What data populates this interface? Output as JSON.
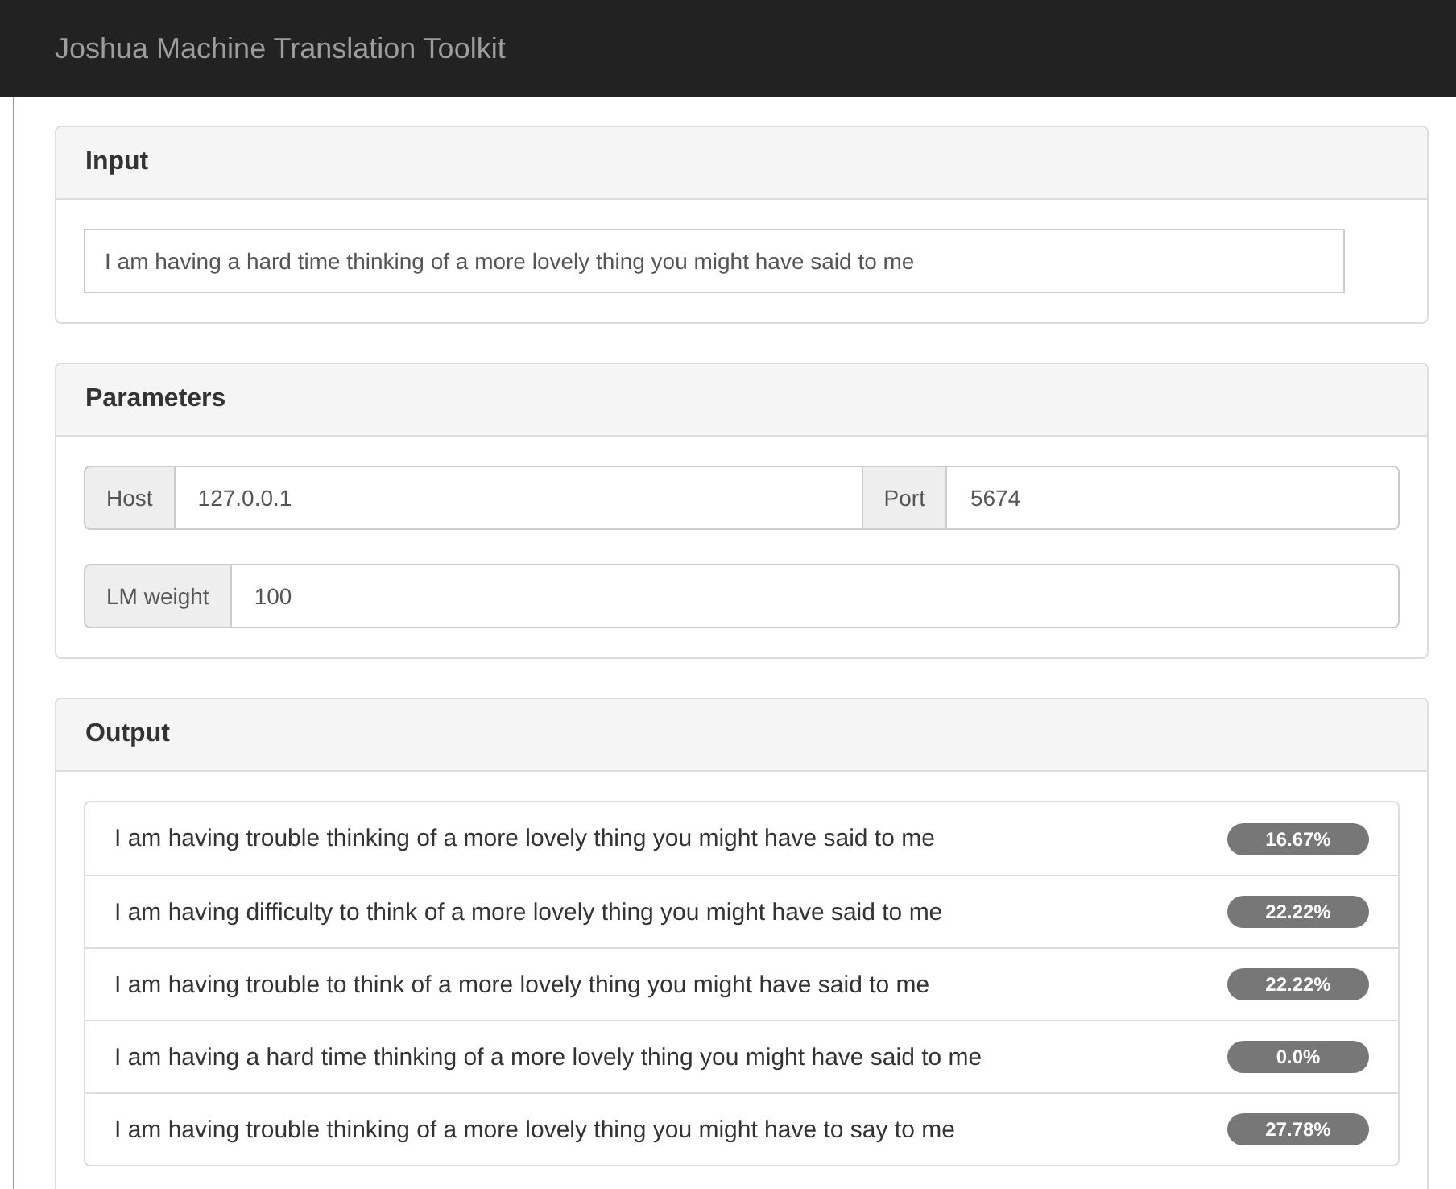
{
  "navbar": {
    "title": "Joshua Machine Translation Toolkit"
  },
  "input_panel": {
    "heading": "Input",
    "value": "I am having a hard time thinking of a more lovely thing you might have said to me"
  },
  "parameters_panel": {
    "heading": "Parameters",
    "rows": [
      {
        "fields": [
          {
            "label": "Host",
            "value": "127.0.0.1"
          },
          {
            "label": "Port",
            "value": "5674"
          }
        ]
      },
      {
        "fields": [
          {
            "label": "LM weight",
            "value": "100"
          }
        ]
      }
    ]
  },
  "output_panel": {
    "heading": "Output",
    "items": [
      {
        "text": "I am having trouble thinking of a more lovely thing you might have said to me",
        "badge": "16.67%"
      },
      {
        "text": "I am having difficulty to think of a more lovely thing you might have said to me",
        "badge": "22.22%"
      },
      {
        "text": "I am having trouble to think of a more lovely thing you might have said to me",
        "badge": "22.22%"
      },
      {
        "text": "I am having a hard time thinking of a more lovely thing you might have said to me",
        "badge": "0.0%"
      },
      {
        "text": "I am having trouble thinking of a more lovely thing you might have to say to me",
        "badge": "27.78%"
      }
    ]
  }
}
